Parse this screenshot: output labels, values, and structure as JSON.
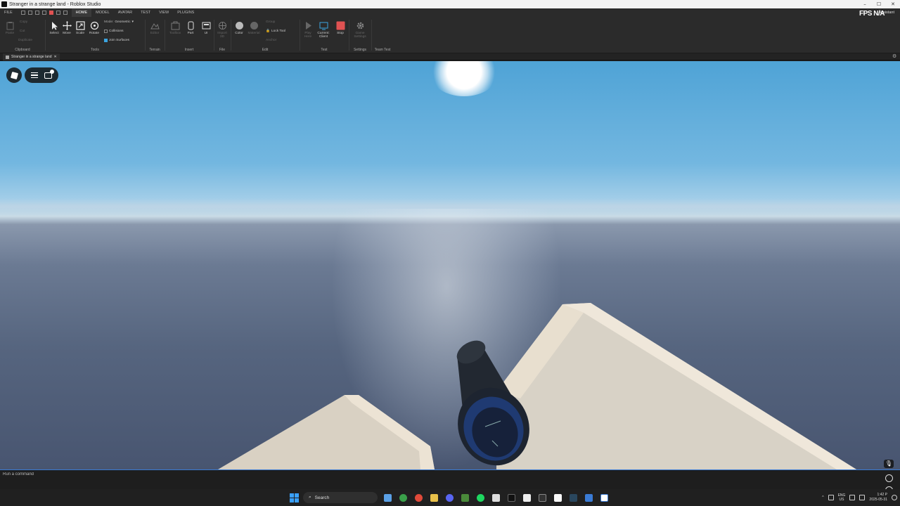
{
  "window": {
    "title": "Stranger in a strange land - Roblox Studio",
    "minimize": "–",
    "maximize": "☐",
    "close": "✕"
  },
  "menubar": {
    "file": "FILE",
    "tabs": [
      "HOME",
      "MODEL",
      "AVATAR",
      "TEST",
      "VIEW",
      "PLUGINS"
    ],
    "active_tab": "HOME",
    "assistant": "Assistant",
    "fps_label": "FPS",
    "fps_value": "N/A"
  },
  "ribbon": {
    "clipboard": {
      "label": "Clipboard",
      "paste": "Paste",
      "copy": "Copy",
      "cut": "Cut",
      "duplicate": "Duplicate"
    },
    "tools": {
      "label": "Tools",
      "select": "Select",
      "move": "Move",
      "scale": "Scale",
      "rotate": "Rotate",
      "mode_label": "Mode:",
      "mode_value": "Geometric",
      "collisions": "Collisions",
      "join_surfaces": "Join Surfaces"
    },
    "terrain": {
      "label": "Terrain",
      "editor": "Editor"
    },
    "insert": {
      "label": "Insert",
      "toolbox": "Toolbox",
      "part": "Part",
      "ui": "UI"
    },
    "file": {
      "label": "File",
      "import_3d": "Import 3D"
    },
    "edit": {
      "label": "Edit",
      "color": "Color",
      "material": "Material",
      "group": "Group",
      "lock_tool": "Lock Tool",
      "anchor": "Anchor"
    },
    "test": {
      "label": "Test",
      "play_here": "Play Here",
      "current_client": "Current: Client",
      "stop": "Stop"
    },
    "settings": {
      "label": "Settings",
      "game_settings": "Game Settings"
    },
    "team_test": {
      "label": "Team Test"
    }
  },
  "document": {
    "tab_label": "Stranger in a strange land",
    "tab_close": "✕"
  },
  "command_bar": {
    "placeholder": "Run a command"
  },
  "taskbar": {
    "search": "Search",
    "lang_line1": "ENG",
    "lang_line2": "US",
    "time": "1:42 P",
    "date": "2025-05-31"
  },
  "colors": {
    "stop_red": "#e05252",
    "accent_blue": "#3ba4e0",
    "sky_top": "#4fa3d6",
    "ocean": "#56657f",
    "block_beige": "#e6dccb"
  }
}
